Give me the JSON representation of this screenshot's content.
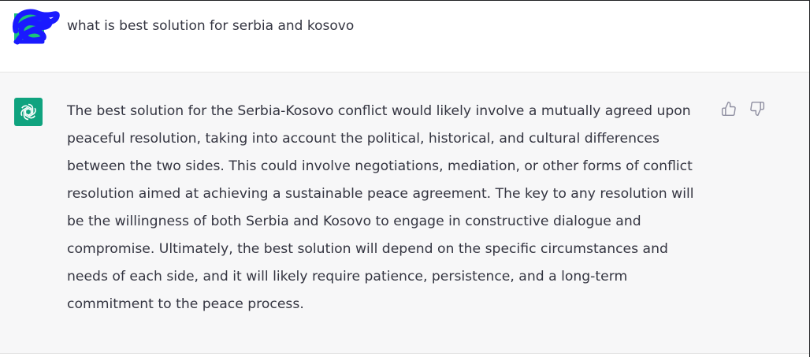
{
  "conversation": {
    "user_message": {
      "text": "what is best solution for serbia and kosovo",
      "avatar_icon": "scribbled-user-avatar-icon"
    },
    "assistant_message": {
      "avatar_icon": "openai-logo-icon",
      "avatar_color": "#10a37f",
      "text": "The best solution for the Serbia-Kosovo conflict would likely involve a mutually agreed upon peaceful resolution, taking into account the political, historical, and cultural differences between the two sides. This could involve negotiations, mediation, or other forms of conflict resolution aimed at achieving a sustainable peace agreement. The key to any resolution will be the willingness of both Serbia and Kosovo to engage in constructive dialogue and compromise. Ultimately, the best solution will depend on the specific circumstances and needs of each side, and it will likely require patience, persistence, and a long-term commitment to the peace process."
    },
    "feedback": {
      "thumbs_up_icon": "thumbs-up-icon",
      "thumbs_down_icon": "thumbs-down-icon"
    }
  },
  "colors": {
    "text": "#343541",
    "assistant_bg": "#f7f7f8",
    "user_bg": "#ffffff",
    "scribble": "#1a1aff",
    "user_avatar_base": "#19c37d"
  }
}
